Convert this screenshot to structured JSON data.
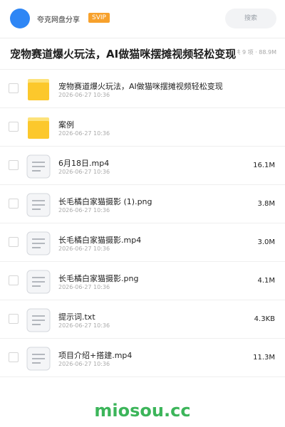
{
  "header": {
    "app_name": "夸克网盘分享",
    "badge": "SVIP",
    "search_label": "搜索"
  },
  "share": {
    "title": "宠物赛道爆火玩法，AI做猫咪摆摊视频轻松变现",
    "meta": "共 9 项 · 88.9M"
  },
  "files": [
    {
      "name": "宠物赛道爆火玩法，AI做猫咪摆摊视频轻松变现",
      "date": "2026-06-27 10:36",
      "size": "",
      "type": "folder"
    },
    {
      "name": "案例",
      "date": "2026-06-27 10:36",
      "size": "",
      "type": "folder"
    },
    {
      "name": "6月18日.mp4",
      "date": "2026-06-27 10:36",
      "size": "16.1M",
      "type": "file"
    },
    {
      "name": "长毛橘白家猫摄影 (1).png",
      "date": "2026-06-27 10:36",
      "size": "3.8M",
      "type": "file"
    },
    {
      "name": "长毛橘白家猫摄影.mp4",
      "date": "2026-06-27 10:36",
      "size": "3.0M",
      "type": "file"
    },
    {
      "name": "长毛橘白家猫摄影.png",
      "date": "2026-06-27 10:36",
      "size": "4.1M",
      "type": "file"
    },
    {
      "name": "提示词.txt",
      "date": "2026-06-27 10:36",
      "size": "4.3KB",
      "type": "file"
    },
    {
      "name": "项目介绍+搭建.mp4",
      "date": "2026-06-27 10:36",
      "size": "11.3M",
      "type": "file"
    }
  ],
  "watermark": "miosou.cc",
  "colors": {
    "accent": "#2e86f5",
    "svip": "#f7a12c",
    "folder": "#fcc82c",
    "watermark": "#3cb55a"
  },
  "icons": {
    "folder": "folder-icon",
    "file": "document-icon"
  }
}
